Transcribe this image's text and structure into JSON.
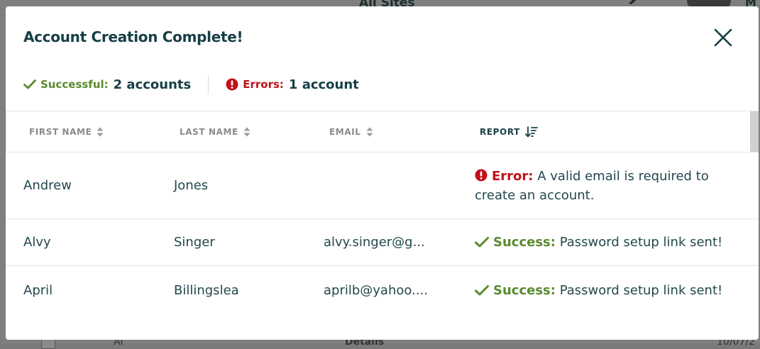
{
  "background": {
    "site_title": "All Sites",
    "user_initial": "M",
    "bottom_row": {
      "name_fragment": "Al",
      "link_fragment": "Details",
      "date_fragment": "10/07/2"
    }
  },
  "modal": {
    "title": "Account Creation Complete!",
    "close_icon": "close-icon",
    "summary": {
      "successful_label": "Successful:",
      "successful_value": "2 accounts",
      "errors_label": "Errors:",
      "errors_value": "1 account"
    },
    "table": {
      "columns": [
        {
          "label": "FIRST NAME",
          "sort_icon": "sort-updown-icon"
        },
        {
          "label": "LAST NAME",
          "sort_icon": "sort-updown-icon"
        },
        {
          "label": "EMAIL",
          "sort_icon": "sort-updown-icon"
        },
        {
          "label": "REPORT",
          "sort_icon": "sort-desc-icon"
        }
      ],
      "rows": [
        {
          "first_name": "Andrew",
          "last_name": "Jones",
          "email": "",
          "status": "Error:",
          "message": "A valid email is required to",
          "message_line2": "create an account."
        },
        {
          "first_name": "Alvy",
          "last_name": "Singer",
          "email": "alvy.singer@g...",
          "status": "Success:",
          "message": "Password setup link sent!"
        },
        {
          "first_name": "April",
          "last_name": "Billingslea",
          "email": "aprilb@yahoo....",
          "status": "Success:",
          "message": "Password setup link sent!"
        }
      ]
    }
  },
  "colors": {
    "title": "#163f45",
    "success": "#5a8a2e",
    "error": "#c0111b",
    "header_text": "#8b8b8b",
    "overlay": "#7f7f7f"
  }
}
